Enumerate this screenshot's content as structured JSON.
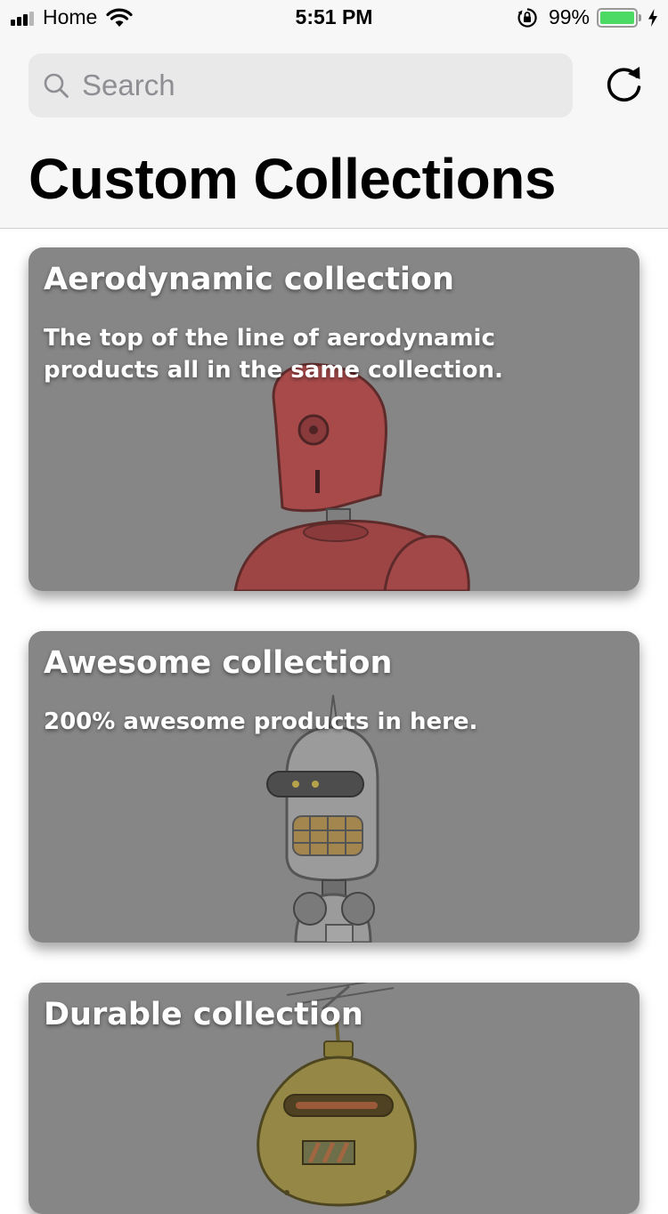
{
  "status_bar": {
    "carrier": "Home",
    "time": "5:51 PM",
    "battery_percent": "99%",
    "battery_level": 0.99,
    "colors": {
      "battery_fill": "#4cd964"
    }
  },
  "search": {
    "placeholder": "Search",
    "value": ""
  },
  "header": {
    "title": "Custom Collections",
    "refresh_icon": "refresh-icon"
  },
  "collections": [
    {
      "title": "Aerodynamic collection",
      "description": "The top of the line of aerodynamic products all in the same collection.",
      "image": "red-robot-illustration"
    },
    {
      "title": "Awesome collection",
      "description": "200% awesome products in here.",
      "image": "grey-robot-illustration"
    },
    {
      "title": "Durable collection",
      "description": "",
      "image": "yellow-robot-illustration"
    }
  ],
  "colors": {
    "card_background": "#868686",
    "nav_background": "#f7f7f7",
    "search_background": "#e9e9ea"
  }
}
